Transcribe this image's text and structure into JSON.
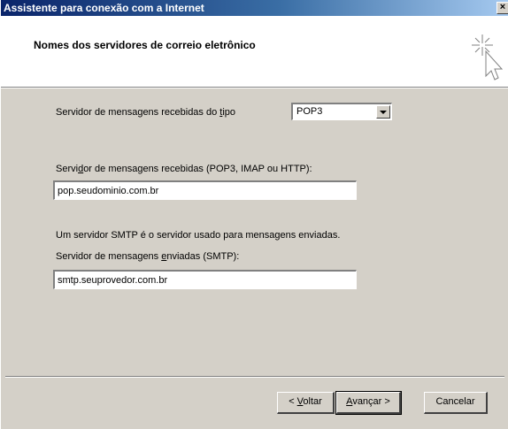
{
  "window": {
    "title": "Assistente para conexão com a Internet",
    "close_glyph": "×"
  },
  "header": {
    "title": "Nomes dos servidores de correio eletrônico",
    "icon": "wizard-sparkle-cursor-icon"
  },
  "incoming_type": {
    "label_pre": "Servidor de mensagens recebidas do ",
    "label_accel": "t",
    "label_post": "ipo",
    "selected": "POP3"
  },
  "incoming_server": {
    "label_pre": "Servi",
    "label_accel": "d",
    "label_post": "or de mensagens recebidas (POP3, IMAP ou HTTP):",
    "value": "pop.seudominio.com.br"
  },
  "smtp_note": "Um servidor SMTP é o servidor usado para mensagens enviadas.",
  "outgoing_server": {
    "label_pre": "Servidor de mensagens ",
    "label_accel": "e",
    "label_post": "nviadas (SMTP):",
    "value": "smtp.seuprovedor.com.br"
  },
  "buttons": {
    "back_pre": "< ",
    "back_accel": "V",
    "back_post": "oltar",
    "next_accel": "A",
    "next_post": "vançar >",
    "cancel": "Cancelar"
  },
  "colors": {
    "title_active": "#0a246a",
    "dialog_face": "#d4d0c8"
  }
}
